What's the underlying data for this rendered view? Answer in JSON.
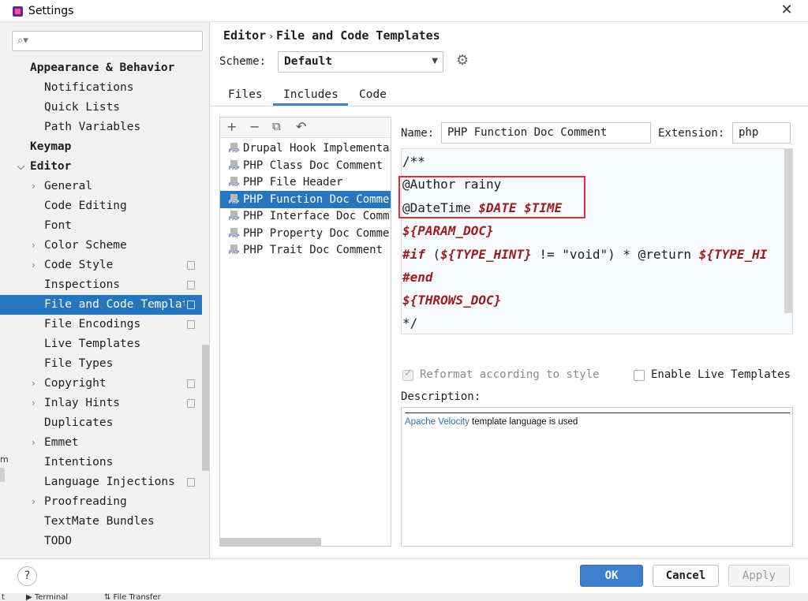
{
  "window": {
    "title": "Settings"
  },
  "search": {
    "placeholder": "Q̇"
  },
  "sidebar": {
    "items": [
      {
        "label": "Appearance & Behavior",
        "bold": true
      },
      {
        "label": "Notifications"
      },
      {
        "label": "Quick Lists"
      },
      {
        "label": "Path Variables"
      },
      {
        "label": "Keymap",
        "bold": true
      },
      {
        "label": "Editor",
        "bold": true,
        "expanded": true
      },
      {
        "label": "General",
        "collapsible": true
      },
      {
        "label": "Code Editing"
      },
      {
        "label": "Font"
      },
      {
        "label": "Color Scheme",
        "collapsible": true
      },
      {
        "label": "Code Style",
        "collapsible": true,
        "project": true
      },
      {
        "label": "Inspections",
        "project": true
      },
      {
        "label": "File and Code Templat",
        "selected": true,
        "project": true
      },
      {
        "label": "File Encodings",
        "project": true
      },
      {
        "label": "Live Templates"
      },
      {
        "label": "File Types"
      },
      {
        "label": "Copyright",
        "collapsible": true,
        "project": true
      },
      {
        "label": "Inlay Hints",
        "collapsible": true,
        "project": true
      },
      {
        "label": "Duplicates"
      },
      {
        "label": "Emmet",
        "collapsible": true
      },
      {
        "label": "Intentions"
      },
      {
        "label": "Language Injections",
        "project": true
      },
      {
        "label": "Proofreading",
        "collapsible": true
      },
      {
        "label": "TextMate Bundles"
      },
      {
        "label": "TODO"
      }
    ]
  },
  "breadcrumb": {
    "parent": "Editor",
    "separator": "›",
    "current": "File and Code Templates"
  },
  "scheme": {
    "label": "Scheme:",
    "value": "Default"
  },
  "tabs": [
    {
      "label": "Files"
    },
    {
      "label": "Includes",
      "active": true
    },
    {
      "label": "Code"
    }
  ],
  "toolbar": {
    "add": "+",
    "remove": "−",
    "copy": "⧉",
    "reset": "↶"
  },
  "templates": [
    {
      "label": "Drupal Hook Implementa"
    },
    {
      "label": "PHP Class Doc Comment"
    },
    {
      "label": "PHP File Header"
    },
    {
      "label": "PHP Function Doc Comme",
      "selected": true
    },
    {
      "label": "PHP Interface Doc Comm"
    },
    {
      "label": "PHP Property Doc Comme"
    },
    {
      "label": "PHP Trait Doc Comment"
    }
  ],
  "php_tag": "PHP",
  "name_field": {
    "label": "Name:",
    "value": "PHP Function Doc Comment"
  },
  "extension_field": {
    "label": "Extension:",
    "value": "php"
  },
  "editor": {
    "line1": "/**",
    "line2": "@Author rainy",
    "line3_prefix": "@DateTime ",
    "line3_var": "$DATE $TIME",
    "line4": "${PARAM_DOC}",
    "line5_kw": "#if",
    "line5_a": " (",
    "line5_var": "${TYPE_HINT}",
    "line5_b": " != \"void\") * @return ",
    "line5_var2": "${TYPE_HI",
    "line6": "#end",
    "line7": "${THROWS_DOC}",
    "line8": "*/"
  },
  "options": {
    "reformat_label": "Reformat according to style",
    "live_templates_label": "Enable Live Templates"
  },
  "description": {
    "label": "Description:",
    "link": "Apache Velocity",
    "text": " template language is used"
  },
  "buttons": {
    "help": "?",
    "ok": "OK",
    "cancel": "Cancel",
    "apply": "Apply"
  },
  "background": {
    "left_char": "m",
    "terminal": "▶ Terminal",
    "file_transfer": "⇅ File Transfer",
    "edge": "t"
  }
}
